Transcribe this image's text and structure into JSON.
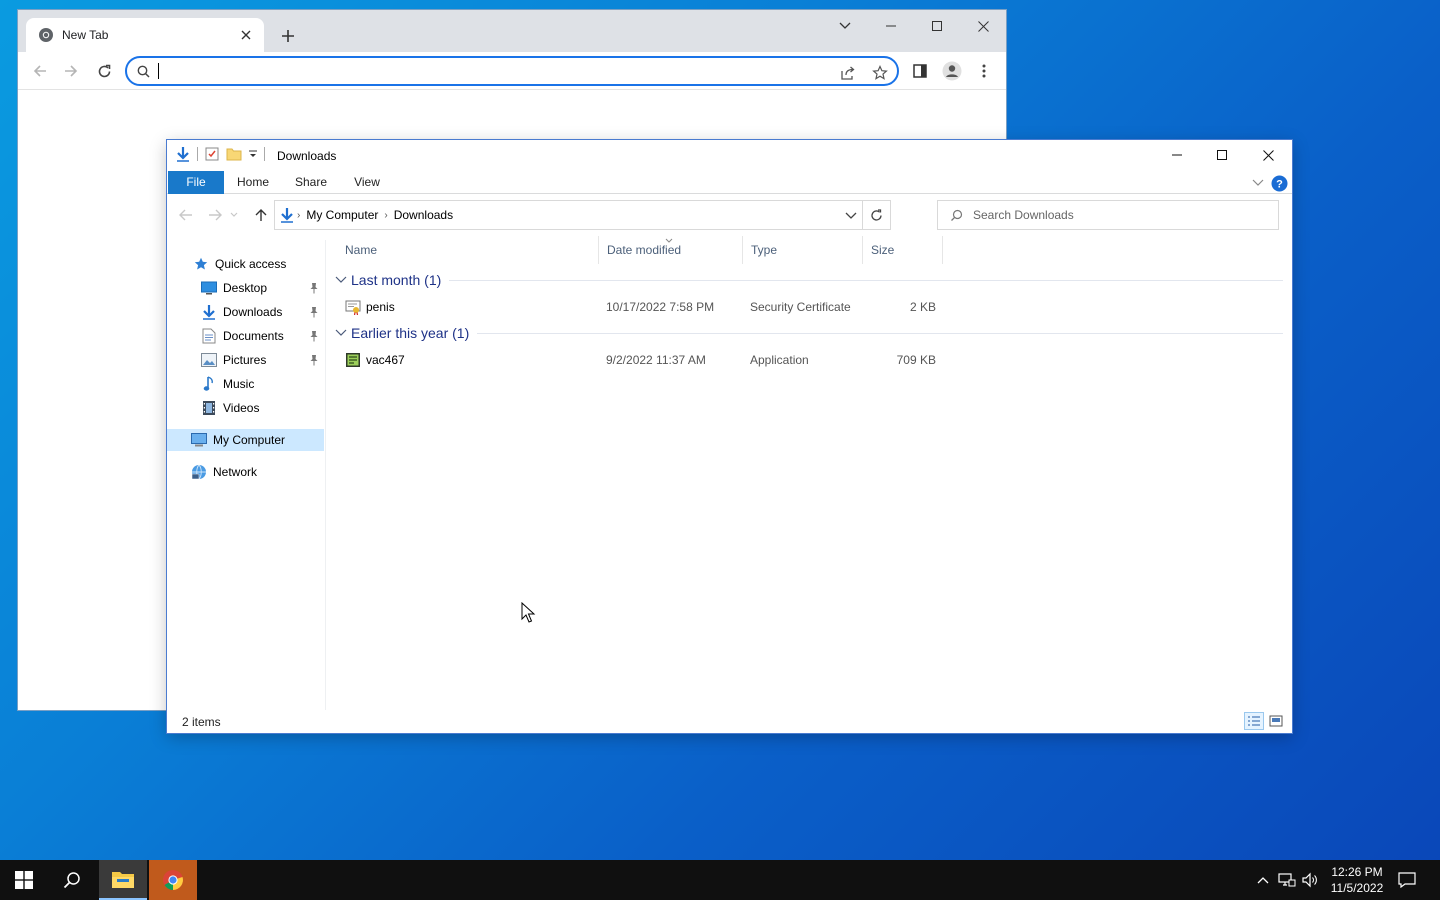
{
  "colors": {
    "accent": "#1979ca",
    "omnibox_focus": "#1a73e8",
    "group_header": "#1e3287",
    "nav_selected": "#cce8ff",
    "taskbar": "#101010"
  },
  "chrome": {
    "tab_title": "New Tab",
    "address_value": "",
    "icons": [
      "chrome-icon",
      "tab-close-icon",
      "new-tab-icon",
      "tab-search-icon",
      "minimize-icon",
      "maximize-icon",
      "close-icon",
      "back-icon",
      "forward-icon",
      "reload-icon",
      "search-icon",
      "share-icon",
      "bookmark-star-icon",
      "side-panel-icon",
      "profile-icon",
      "menu-icon"
    ]
  },
  "explorer": {
    "title": "Downloads",
    "ribbon_tabs": {
      "file": "File",
      "home": "Home",
      "share": "Share",
      "view": "View"
    },
    "breadcrumb": {
      "root": "My Computer",
      "current": "Downloads"
    },
    "search_placeholder": "Search Downloads",
    "nav": {
      "quick_access": "Quick access",
      "desktop": "Desktop",
      "downloads": "Downloads",
      "documents": "Documents",
      "pictures": "Pictures",
      "music": "Music",
      "videos": "Videos",
      "my_computer": "My Computer",
      "network": "Network"
    },
    "columns": {
      "name": "Name",
      "date": "Date modified",
      "type": "Type",
      "size": "Size"
    },
    "groups": [
      {
        "label": "Last month (1)",
        "files": [
          {
            "name": "penis",
            "date": "10/17/2022 7:58 PM",
            "type": "Security Certificate",
            "size": "2 KB",
            "icon": "certificate-icon"
          }
        ]
      },
      {
        "label": "Earlier this year (1)",
        "files": [
          {
            "name": "vac467",
            "date": "9/2/2022 11:37 AM",
            "type": "Application",
            "size": "709 KB",
            "icon": "application-icon"
          }
        ]
      }
    ],
    "status": {
      "item_count": "2 items"
    }
  },
  "taskbar": {
    "time": "12:26 PM",
    "date": "11/5/2022",
    "icons": [
      "start-icon",
      "search-icon",
      "file-explorer-icon",
      "chrome-icon",
      "show-hidden-icons",
      "network-icon",
      "volume-icon",
      "notifications-icon"
    ]
  }
}
